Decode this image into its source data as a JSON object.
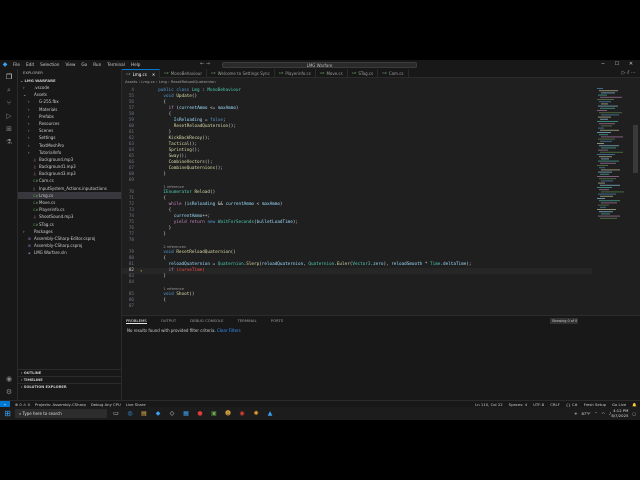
{
  "titlebar": {
    "menu": [
      "File",
      "Edit",
      "Selection",
      "View",
      "Go",
      "Run",
      "Terminal",
      "Help"
    ],
    "search": "LMG Warfare",
    "window_controls": [
      "─",
      "☐",
      "✕"
    ]
  },
  "activity_icons": [
    "explorer-icon",
    "search-icon",
    "source-control-icon",
    "run-debug-icon",
    "extensions-icon",
    "test-icon",
    "account-icon",
    "settings-icon"
  ],
  "sidebar": {
    "header": "EXPLORER",
    "project": "LMG WARFARE",
    "tree": [
      {
        "label": ".vscode",
        "indent": 1,
        "arrow": "›",
        "icon": "folder"
      },
      {
        "label": "Assets",
        "indent": 1,
        "arrow": "⌄",
        "icon": "folder"
      },
      {
        "label": "G-255.fbx",
        "indent": 2,
        "arrow": "›",
        "icon": "folder"
      },
      {
        "label": "Materials",
        "indent": 2,
        "arrow": "›",
        "icon": "folder"
      },
      {
        "label": "Prefabs",
        "indent": 2,
        "arrow": "›",
        "icon": "folder"
      },
      {
        "label": "Resources",
        "indent": 2,
        "arrow": "›",
        "icon": "folder"
      },
      {
        "label": "Scenes",
        "indent": 2,
        "arrow": "›",
        "icon": "folder"
      },
      {
        "label": "Settings",
        "indent": 2,
        "arrow": "›",
        "icon": "folder"
      },
      {
        "label": "TextMeshPro",
        "indent": 2,
        "arrow": "›",
        "icon": "folder"
      },
      {
        "label": "TutorialInfo",
        "indent": 2,
        "arrow": "›",
        "icon": "folder"
      },
      {
        "label": "Background.mp3",
        "indent": 2,
        "arrow": "",
        "icon": "audio"
      },
      {
        "label": "Background1.mp3",
        "indent": 2,
        "arrow": "",
        "icon": "audio"
      },
      {
        "label": "Background3.mp3",
        "indent": 2,
        "arrow": "",
        "icon": "audio"
      },
      {
        "label": "Cam.cs",
        "indent": 2,
        "arrow": "",
        "icon": "cs"
      },
      {
        "label": "InputSystem_Actions.inputactions",
        "indent": 2,
        "arrow": "",
        "icon": "file"
      },
      {
        "label": "Lmg.cs",
        "indent": 2,
        "arrow": "",
        "icon": "cs",
        "selected": true
      },
      {
        "label": "Move.cs",
        "indent": 2,
        "arrow": "",
        "icon": "cs"
      },
      {
        "label": "Playerinfo.cs",
        "indent": 2,
        "arrow": "",
        "icon": "cs"
      },
      {
        "label": "ShootSound.mp3",
        "indent": 2,
        "arrow": "",
        "icon": "audio"
      },
      {
        "label": "STag.cs",
        "indent": 2,
        "arrow": "",
        "icon": "cs"
      },
      {
        "label": "Packages",
        "indent": 1,
        "arrow": "›",
        "icon": "folder"
      },
      {
        "label": "Assembly-CSharp-Editor.csproj",
        "indent": 1,
        "arrow": "",
        "icon": "proj"
      },
      {
        "label": "Assembly-CSharp.csproj",
        "indent": 1,
        "arrow": "",
        "icon": "proj"
      },
      {
        "label": "LMG Warfare.sln",
        "indent": 1,
        "arrow": "",
        "icon": "sln"
      }
    ],
    "bottom_sections": [
      "OUTLINE",
      "TIMELINE",
      "SOLUTION EXPLORER"
    ]
  },
  "tabs": [
    {
      "label": "Lmg.cs",
      "active": true
    },
    {
      "label": "MonoBehaviour",
      "active": false
    },
    {
      "label": "Welcome to Settings Sync",
      "active": false
    },
    {
      "label": "Playerinfo.cs",
      "active": false
    },
    {
      "label": "Move.cs",
      "active": false
    },
    {
      "label": "STag.cs",
      "active": false
    },
    {
      "label": "Cam.cs",
      "active": false
    }
  ],
  "breadcrumb": "Assets › Lmg.cs › Lmg › ResetReloadQuaternion",
  "editor": {
    "lines": [
      {
        "num": "4",
        "html": "<span class='k'>public</span> <span class='k'>class</span> <span class='t'>Lmg</span> <span class='p'>:</span> <span class='t'>MonoBehaviour</span>",
        "indent": 2
      },
      {
        "num": "55",
        "html": "<span class='k'>void</span> <span class='f'>Update</span><span class='p'>()</span>",
        "indent": 4
      },
      {
        "num": "56",
        "html": "<span class='p'>{</span>",
        "indent": 4
      },
      {
        "num": "57",
        "html": "<span class='c'>if</span> <span class='p'>(</span><span class='v'>currentAmmo</span> <span class='p'>&lt;=</span> <span class='v'>maxAmmo</span><span class='p'>)</span>",
        "indent": 6
      },
      {
        "num": "58",
        "html": "<span class='p'>{</span>",
        "indent": 6
      },
      {
        "num": "59",
        "html": "<span class='v'>IsReloading</span> <span class='p'>=</span> <span class='k'>false</span><span class='p'>;</span>",
        "indent": 8
      },
      {
        "num": "60",
        "html": "<span class='f'>ResetReloadQuaternion</span><span class='p'>();</span>",
        "indent": 8
      },
      {
        "num": "61",
        "html": "<span class='p'>}</span>",
        "indent": 6
      },
      {
        "num": "62",
        "html": "<span class='f'>KickBackRecoy</span><span class='p'>();</span>",
        "indent": 6
      },
      {
        "num": "63",
        "html": "<span class='f'>Tactical</span><span class='p'>();</span>",
        "indent": 6
      },
      {
        "num": "64",
        "html": "<span class='f'>Sprinting</span><span class='p'>();</span>",
        "indent": 6
      },
      {
        "num": "65",
        "html": "<span class='f'>Sway</span><span class='p'>();</span>",
        "indent": 6
      },
      {
        "num": "66",
        "html": "<span class='f'>CombineVectors</span><span class='p'>();</span>",
        "indent": 6
      },
      {
        "num": "67",
        "html": "<span class='f'>CombineQuaternions</span><span class='p'>();</span>",
        "indent": 6
      },
      {
        "num": "68",
        "html": "<span class='p'>}</span>",
        "indent": 4
      },
      {
        "num": "69",
        "html": "",
        "indent": 0
      },
      {
        "num": "",
        "html": "<span class='lens'>1 reference</span>",
        "indent": 4
      },
      {
        "num": "70",
        "html": "<span class='t'>IEnumerator</span> <span class='f'>Reload</span><span class='p'>()</span>",
        "indent": 4
      },
      {
        "num": "71",
        "html": "<span class='p'>{</span>",
        "indent": 4
      },
      {
        "num": "72",
        "html": "<span class='c'>while</span> <span class='p'>(</span><span class='v'>isReloading</span> <span class='p'>&amp;&amp;</span> <span class='v'>currentAmmo</span> <span class='p'>&lt;</span> <span class='v'>maxAmmo</span><span class='p'>)</span>",
        "indent": 6
      },
      {
        "num": "73",
        "html": "<span class='p'>{</span>",
        "indent": 6
      },
      {
        "num": "74",
        "html": "<span class='v'>currentAmmo</span><span class='p'>++;</span>",
        "indent": 8
      },
      {
        "num": "75",
        "html": "<span class='c'>yield</span> <span class='c'>return</span> <span class='k'>new</span> <span class='t'>WaitForSeconds</span><span class='p'>(</span><span class='v'>bulletLoadTime</span><span class='p'>);</span>",
        "indent": 8
      },
      {
        "num": "76",
        "html": "<span class='p'>}</span>",
        "indent": 6
      },
      {
        "num": "77",
        "html": "<span class='p'>}</span>",
        "indent": 4
      },
      {
        "num": "78",
        "html": "",
        "indent": 0
      },
      {
        "num": "",
        "html": "<span class='lens'>2 references</span>",
        "indent": 4
      },
      {
        "num": "79",
        "html": "<span class='k'>void</span> <span class='f'>ResetReloadQuaternion</span><span class='p'>()</span>",
        "indent": 4
      },
      {
        "num": "80",
        "html": "<span class='p'>{</span>",
        "indent": 4
      },
      {
        "num": "81",
        "html": "<span class='v'>reloadQuaternion</span> <span class='p'>=</span> <span class='t'>Quaternion</span><span class='p'>.</span><span class='f'>Slerp</span><span class='p'>(</span><span class='v'>reloadQuaternion</span><span class='p'>,</span> <span class='t'>Quaternion</span><span class='p'>.</span><span class='f'>Euler</span><span class='p'>(</span><span class='t'>Vector3</span><span class='p'>.</span><span class='v'>zero</span><span class='p'>),</span> <span class='v'>reloadSmooth</span> <span class='p'>*</span> <span class='t'>Time</span><span class='p'>.</span><span class='v'>deltaTime</span><span class='p'>);</span>",
        "indent": 6
      },
      {
        "num": "82",
        "html": "<span class='c'>if</span> <span class='r'>(curveTime)</span>",
        "indent": 6,
        "current": true,
        "bulb": true
      },
      {
        "num": "83",
        "html": "<span class='p'>}</span>",
        "indent": 4
      },
      {
        "num": "84",
        "html": "",
        "indent": 0
      },
      {
        "num": "",
        "html": "<span class='lens'>1 reference</span>",
        "indent": 4
      },
      {
        "num": "85",
        "html": "<span class='k'>void</span> <span class='f'>Shoot</span><span class='p'>()</span>",
        "indent": 4
      },
      {
        "num": "86",
        "html": "<span class='p'>{</span>",
        "indent": 4
      },
      {
        "num": "87",
        "html": "",
        "indent": 0
      }
    ]
  },
  "panel": {
    "tabs": [
      "PROBLEMS",
      "OUTPUT",
      "DEBUG CONSOLE",
      "TERMINAL",
      "PORTS"
    ],
    "filter_text": "Showing 0 of 0",
    "message": "No results found with provided filter criteria.",
    "clear_link": "Clear Filters"
  },
  "statusbar": {
    "left": [
      "⊗ 0 ⚠ 0",
      "Projects: Assembly-CSharp",
      "Debug Any CPU",
      "Live Share"
    ],
    "right": [
      "Ln 110, Col 22",
      "Spaces: 4",
      "UTF-8",
      "CRLF",
      "{} C#",
      "Fresh Setup",
      "Go Live"
    ]
  },
  "taskbar": {
    "search_placeholder": "Type here to search",
    "weather": "87°F",
    "time": "4:12 PM",
    "date": "8/7/2025"
  }
}
